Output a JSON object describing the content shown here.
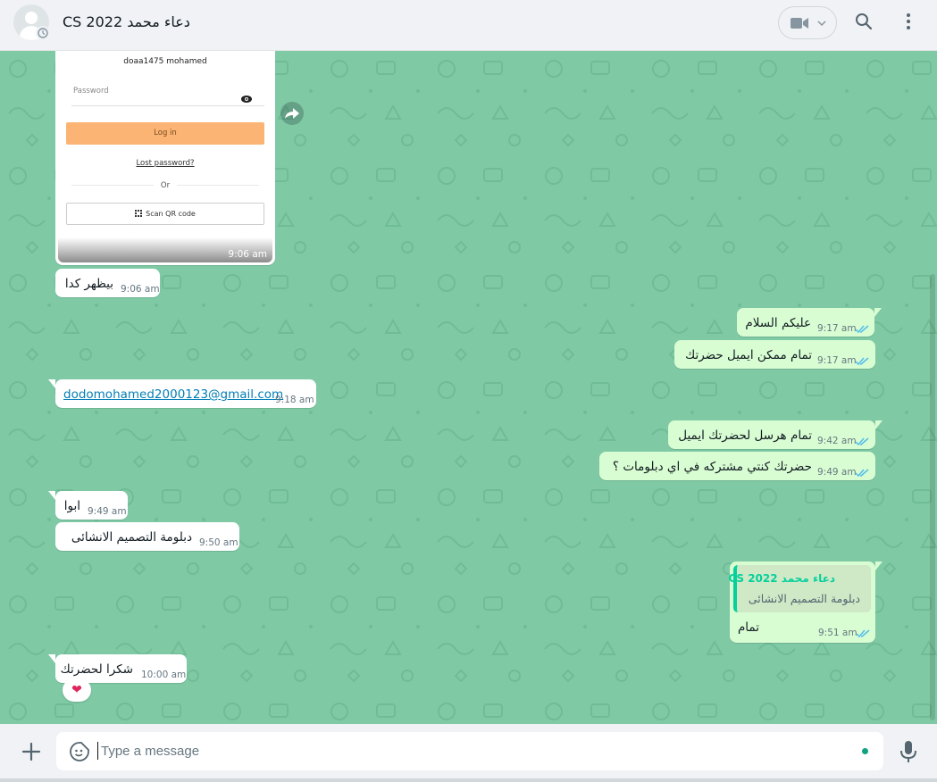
{
  "header": {
    "contact_name": "دعاء محمد CS 2022",
    "icons": [
      "default-avatar-icon",
      "video-camera-icon",
      "chevron-down-icon",
      "search-icon",
      "kebab-menu-icon"
    ]
  },
  "image_message": {
    "username": "doaa1475 mohamed",
    "password_label": "Password",
    "login_button": "Log in",
    "lost_password": "Lost password?",
    "or_text": "Or",
    "qr_button": "Scan QR code",
    "time": "9:06 am"
  },
  "messages": [
    {
      "dir": "in",
      "text": "بيظهر كدا",
      "time": "9:06 am"
    },
    {
      "dir": "out",
      "text": "عليكم السلام",
      "time": "9:17 am"
    },
    {
      "dir": "out",
      "text": "تمام ممكن ايميل حضرتك",
      "time": "9:17 am"
    },
    {
      "dir": "in",
      "text": "dodomohamed2000123@gmail.com",
      "time": "9:18 am",
      "link": true
    },
    {
      "dir": "out",
      "text": "تمام هرسل لحضرتك ايميل",
      "time": "9:42 am"
    },
    {
      "dir": "out",
      "text": "حضرتك كنتي مشتركه في اي دبلومات ؟",
      "time": "9:49 am"
    },
    {
      "dir": "in",
      "text": "ابوا",
      "time": "9:49 am"
    },
    {
      "dir": "in",
      "text": "دبلومة التصميم الانشائى",
      "time": "9:50 am"
    },
    {
      "dir": "out",
      "text": "تمام",
      "time": "9:51 am",
      "quote_author": "دعاء محمد CS 2022",
      "quote_text": "دبلومة التصميم الانشائى"
    },
    {
      "dir": "in",
      "text": "شكرا لحضرتك",
      "time": "10:00 am"
    }
  ],
  "reaction": "❤",
  "composer": {
    "placeholder": "Type a message"
  },
  "colors": {
    "chat_bg": "#7fcaa5",
    "outgoing_bubble": "#d9fdd3",
    "incoming_bubble": "#ffffff",
    "read_tick": "#53bdeb",
    "link": "#027eb5",
    "quote_accent": "#06cf9c"
  }
}
